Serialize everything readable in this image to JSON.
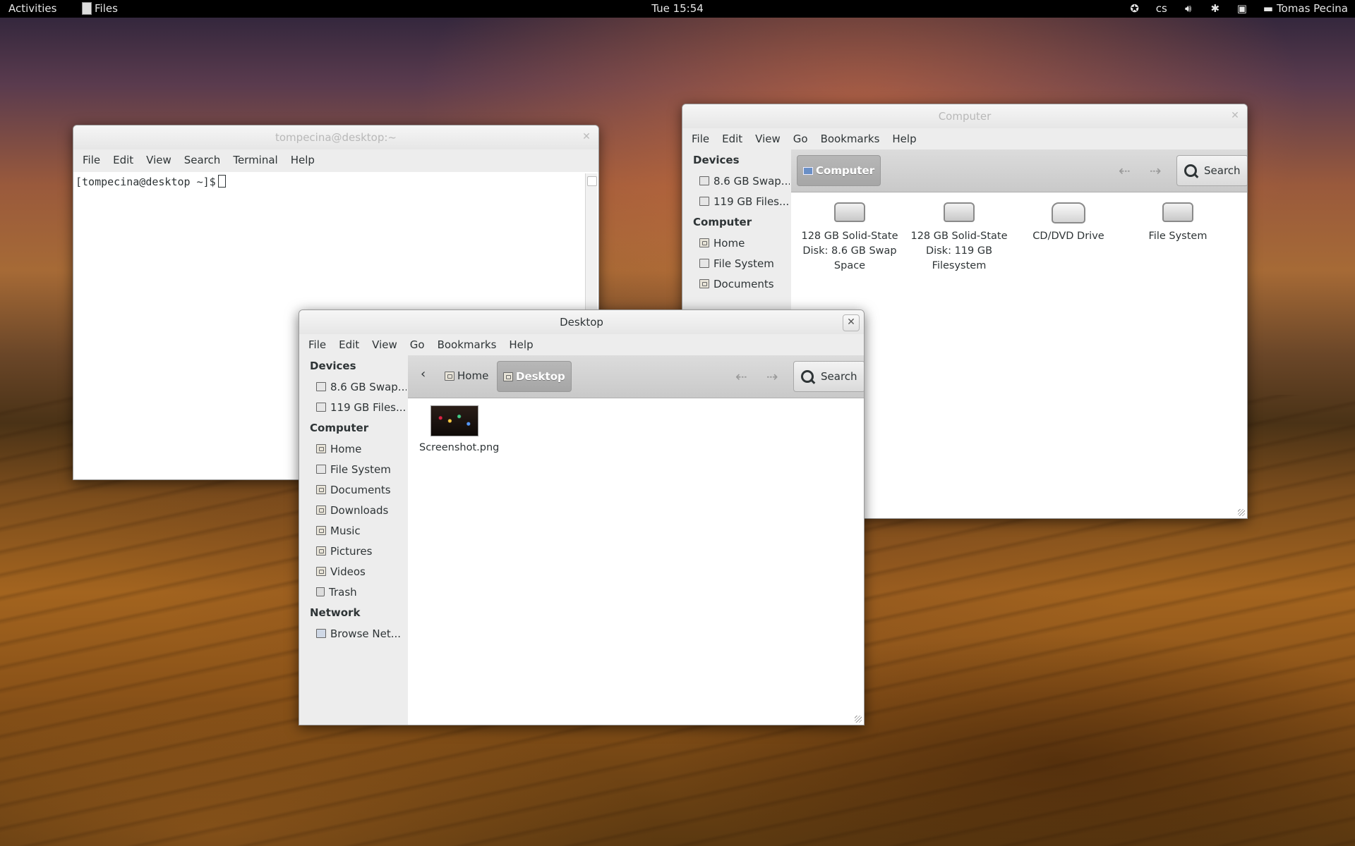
{
  "topbar": {
    "activities": "Activities",
    "app_name": "Files",
    "clock": "Tue 15:54",
    "keyboard_layout": "cs",
    "user": "Tomas Pecina"
  },
  "terminal": {
    "title": "tompecina@desktop:~",
    "menu": [
      "File",
      "Edit",
      "View",
      "Search",
      "Terminal",
      "Help"
    ],
    "prompt": "[tompecina@desktop ~]$"
  },
  "computer_window": {
    "title": "Computer",
    "menu": [
      "File",
      "Edit",
      "View",
      "Go",
      "Bookmarks",
      "Help"
    ],
    "sidebar": {
      "devices_header": "Devices",
      "devices": [
        "8.6 GB Swap...",
        "119 GB Files..."
      ],
      "computer_header": "Computer",
      "places": [
        "Home",
        "File System",
        "Documents"
      ]
    },
    "crumb": "Computer",
    "search": "Search",
    "items": [
      {
        "label": "128 GB Solid-State Disk: 8.6 GB Swap Space",
        "icon": "drive"
      },
      {
        "label": "128 GB Solid-State Disk: 119 GB Filesystem",
        "icon": "drive"
      },
      {
        "label": "CD/DVD Drive",
        "icon": "optical"
      },
      {
        "label": "File System",
        "icon": "drive"
      }
    ]
  },
  "desktop_window": {
    "title": "Desktop",
    "menu": [
      "File",
      "Edit",
      "View",
      "Go",
      "Bookmarks",
      "Help"
    ],
    "sidebar": {
      "devices_header": "Devices",
      "devices": [
        "8.6 GB Swap...",
        "119 GB Files..."
      ],
      "computer_header": "Computer",
      "places": [
        "Home",
        "File System",
        "Documents",
        "Downloads",
        "Music",
        "Pictures",
        "Videos",
        "Trash"
      ],
      "network_header": "Network",
      "network": [
        "Browse Net..."
      ]
    },
    "crumbs": [
      "Home",
      "Desktop"
    ],
    "search": "Search",
    "files": [
      {
        "label": "Screenshot.png",
        "icon": "image-thumbnail"
      }
    ]
  }
}
